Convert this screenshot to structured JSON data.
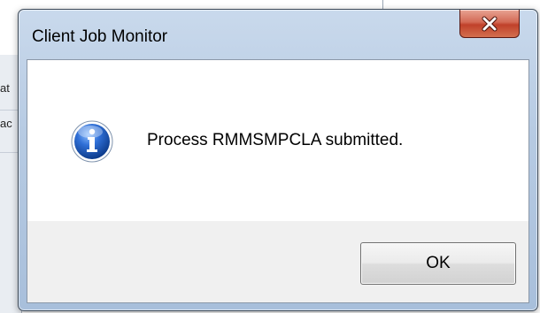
{
  "background": {
    "text_fragments": [
      "at",
      "ac"
    ]
  },
  "dialog": {
    "title": "Client Job Monitor",
    "close_label": "X",
    "message": "Process RMMSMPCLA submitted.",
    "icon": "information-icon",
    "ok_label": "OK"
  },
  "colors": {
    "close_button": "#c7462f",
    "titlebar": "#b7cbe3",
    "info_icon": "#1f5fbf"
  }
}
